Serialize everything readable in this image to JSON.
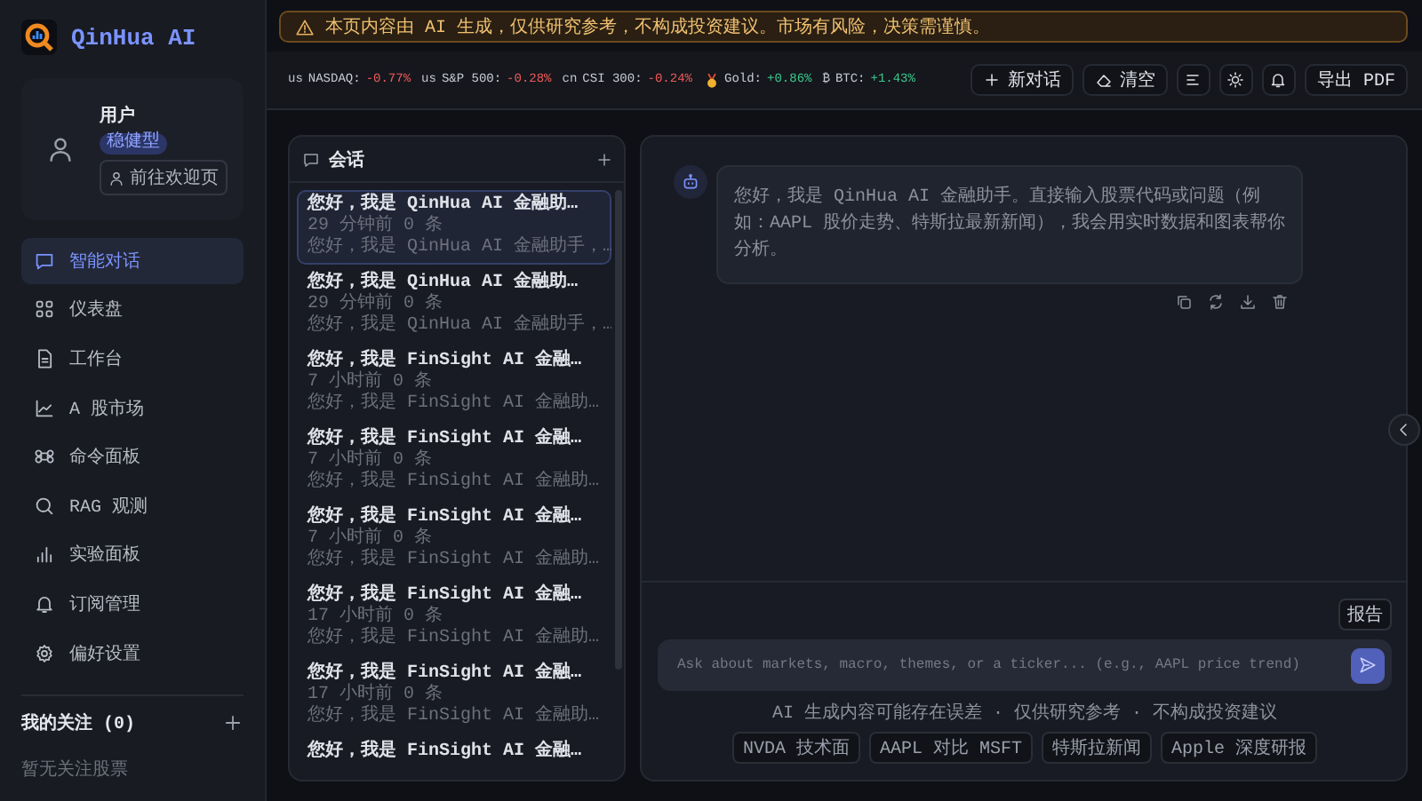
{
  "brand": {
    "name": "QinHua AI"
  },
  "user": {
    "name": "用户",
    "badge": "稳健型",
    "link": "前往欢迎页"
  },
  "nav": [
    {
      "label": "智能对话",
      "selected": true
    },
    {
      "label": "仪表盘",
      "selected": false
    },
    {
      "label": "工作台",
      "selected": false
    },
    {
      "label": "A 股市场",
      "selected": false
    },
    {
      "label": "命令面板",
      "selected": false
    },
    {
      "label": "RAG 观测",
      "selected": false
    },
    {
      "label": "实验面板",
      "selected": false
    },
    {
      "label": "订阅管理",
      "selected": false
    },
    {
      "label": "偏好设置",
      "selected": false
    }
  ],
  "watchlist": {
    "title": "我的关注 (0)",
    "empty": "暂无关注股票"
  },
  "alert": {
    "text": "本页内容由 AI 生成，仅供研究参考，不构成投资建议。市场有风险，决策需谨慎。"
  },
  "tickers": [
    {
      "kind": "text",
      "flag": "us",
      "label": "NASDAQ:",
      "change": "-0.77%",
      "color": "#f05a5a"
    },
    {
      "kind": "text",
      "flag": "us",
      "label": "S&P 500:",
      "change": "-0.28%",
      "color": "#f05a5a"
    },
    {
      "kind": "text",
      "flag": "cn",
      "label": "CSI 300:",
      "change": "-0.24%",
      "color": "#f05a5a"
    },
    {
      "kind": "icon",
      "label": "Gold:",
      "change": "+0.86%",
      "color": "#3cc88c"
    },
    {
      "kind": "text",
      "flag": "₿",
      "label": "BTC:",
      "change": "+1.43%",
      "color": "#3cc88c"
    }
  ],
  "toolbar": [
    {
      "kind": "text",
      "label": "新对话"
    },
    {
      "kind": "text",
      "label": "清空"
    },
    {
      "kind": "icon"
    },
    {
      "kind": "icon"
    },
    {
      "kind": "icon"
    },
    {
      "kind": "text",
      "label": "导出 PDF"
    }
  ],
  "conversations": {
    "title": "会话",
    "items": [
      {
        "title": "您好，我是 QinHua AI 金融助…",
        "meta": "29 分钟前 0 条",
        "preview": "您好，我是 QinHua AI 金融助手，…",
        "selected": true
      },
      {
        "title": "您好，我是 QinHua AI 金融助…",
        "meta": "29 分钟前 0 条",
        "preview": "您好，我是 QinHua AI 金融助手，…",
        "selected": false
      },
      {
        "title": "您好，我是 FinSight AI 金融…",
        "meta": "7 小时前 0 条",
        "preview": "您好，我是 FinSight AI 金融助…",
        "selected": false
      },
      {
        "title": "您好，我是 FinSight AI 金融…",
        "meta": "7 小时前 0 条",
        "preview": "您好，我是 FinSight AI 金融助…",
        "selected": false
      },
      {
        "title": "您好，我是 FinSight AI 金融…",
        "meta": "7 小时前 0 条",
        "preview": "您好，我是 FinSight AI 金融助…",
        "selected": false
      },
      {
        "title": "您好，我是 FinSight AI 金融…",
        "meta": "17 小时前 0 条",
        "preview": "您好，我是 FinSight AI 金融助…",
        "selected": false
      },
      {
        "title": "您好，我是 FinSight AI 金融…",
        "meta": "17 小时前 0 条",
        "preview": "您好，我是 FinSight AI 金融助…",
        "selected": false
      },
      {
        "title": "您好，我是 FinSight AI 金融…",
        "selected": false
      }
    ]
  },
  "chat": {
    "message": "您好，我是 QinHua AI 金融助手。直接输入股票代码或问题（例如：AAPL 股价走势、特斯拉最新新闻），我会用实时数据和图表帮你分析。",
    "report": "报告",
    "input": {
      "placeholder": "Ask about markets, macro, themes, or a ticker... (e.g., AAPL price trend)"
    },
    "disclaimer": "AI 生成内容可能存在误差 · 仅供研究参考 · 不构成投资建议",
    "suggestions": [
      "NVDA 技术面",
      "AAPL 对比 MSFT",
      "特斯拉新闻",
      "Apple 深度研报"
    ]
  }
}
